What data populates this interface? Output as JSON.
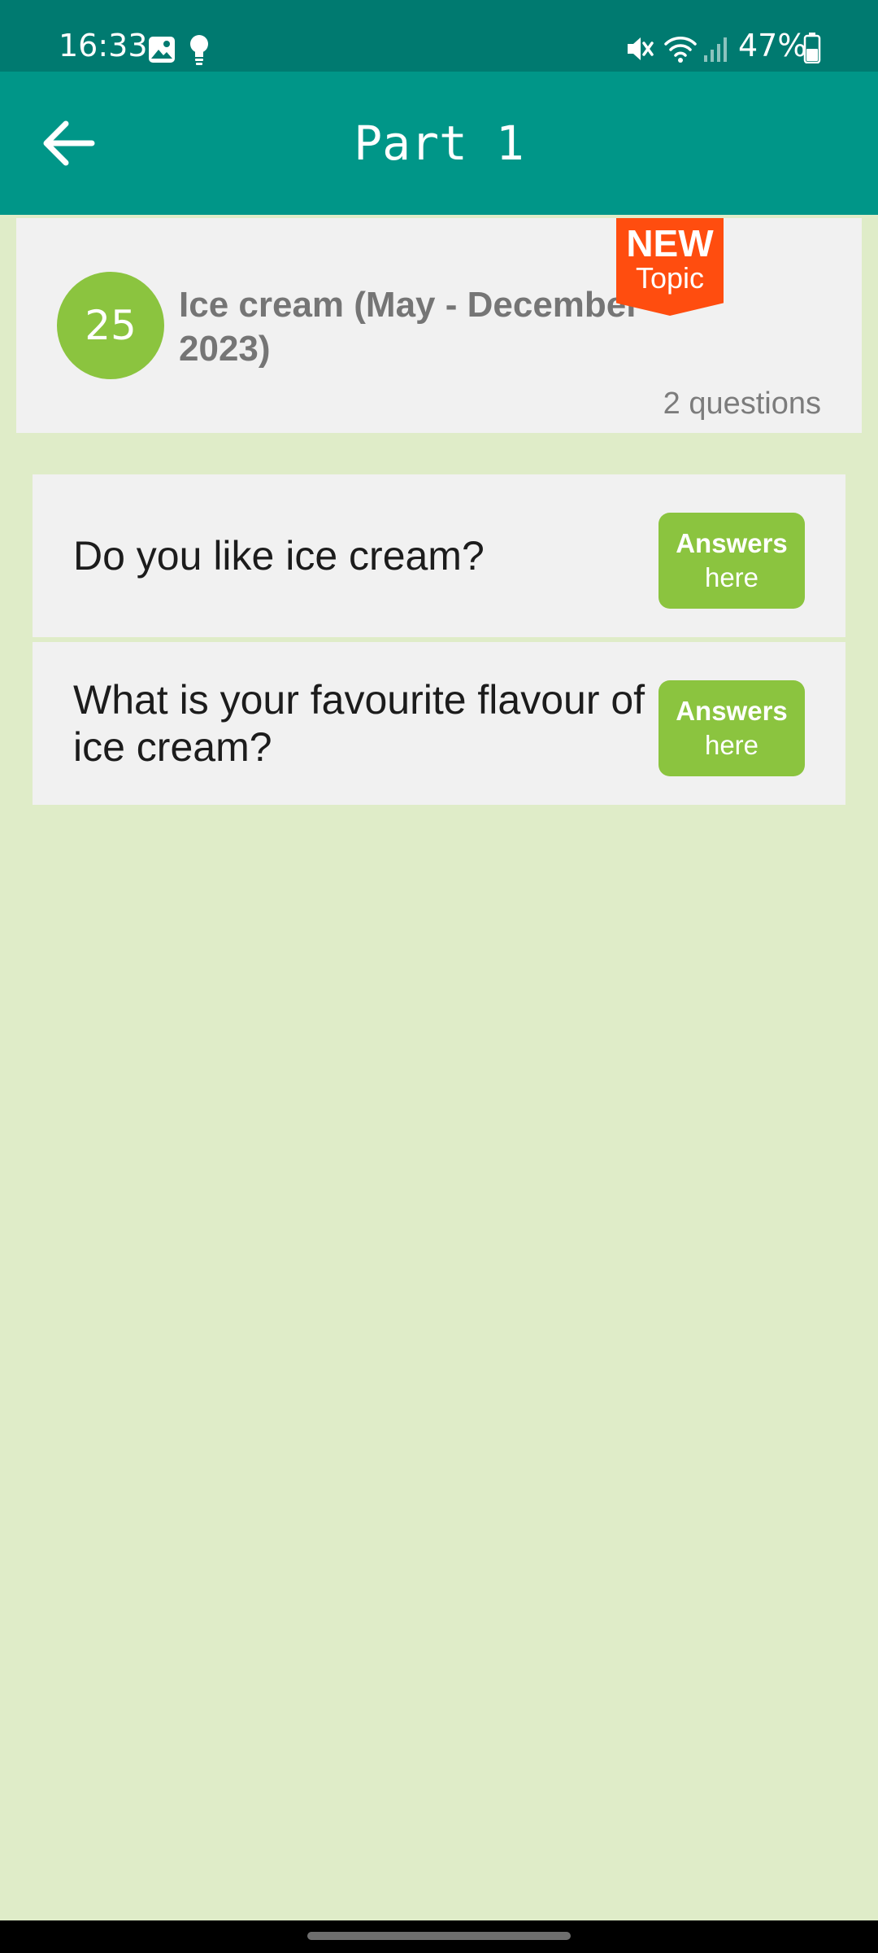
{
  "status_bar": {
    "time": "16:33",
    "battery": "47%",
    "icons": [
      "gallery-icon",
      "bulb-icon",
      "mute-icon",
      "wifi-icon",
      "signal-icon",
      "battery-icon"
    ]
  },
  "app_bar": {
    "title": "Part 1",
    "back_icon": "arrow-left-icon"
  },
  "topic": {
    "number": "25",
    "title": "Ice cream (May - December 2023)",
    "badge": {
      "line1": "NEW",
      "line2": "Topic",
      "color": "#ff4d0f"
    },
    "question_count": "2 questions"
  },
  "questions": [
    {
      "text": "Do you like ice cream?",
      "button": {
        "line1": "Answers",
        "line2": "here"
      }
    },
    {
      "text": "What is your favourite flavour of ice cream?",
      "button": {
        "line1": "Answers",
        "line2": "here"
      }
    }
  ],
  "colors": {
    "status_bar": "#007a70",
    "app_bar": "#009688",
    "accent_green": "#8bc43f",
    "background": "#dfecc8",
    "card": "#f1f1f1"
  }
}
